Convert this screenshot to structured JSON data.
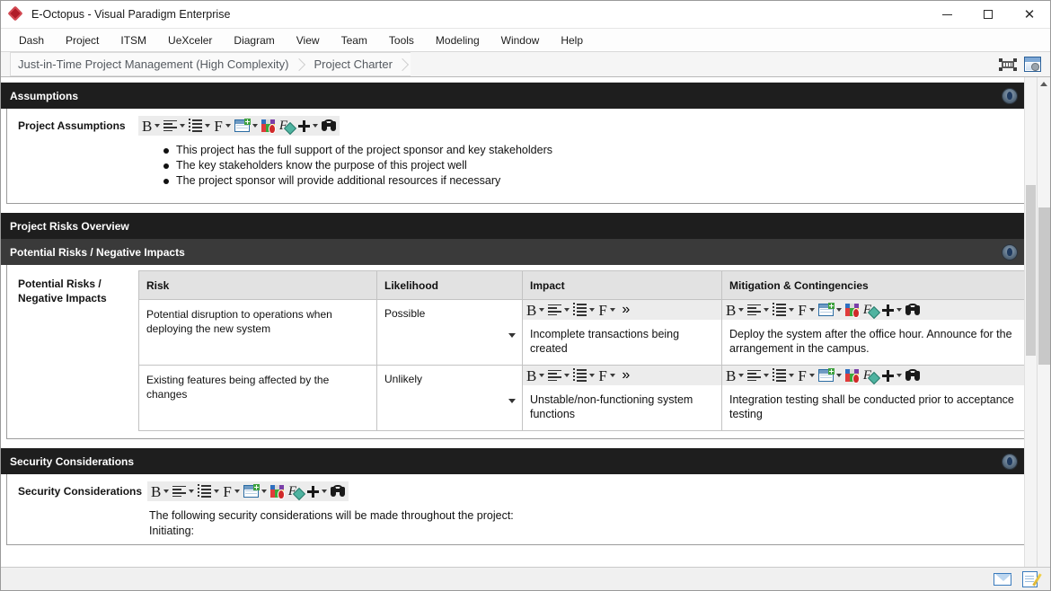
{
  "window": {
    "title": "E-Octopus - Visual Paradigm Enterprise",
    "logo_icon": "vp-diamond-logo",
    "minimize_label": "—",
    "maximize_label": "□",
    "close_label": "✕"
  },
  "menu": {
    "items": [
      {
        "label": "Dash"
      },
      {
        "label": "Project"
      },
      {
        "label": "ITSM"
      },
      {
        "label": "UeXceler"
      },
      {
        "label": "Diagram"
      },
      {
        "label": "View"
      },
      {
        "label": "Team"
      },
      {
        "label": "Tools"
      },
      {
        "label": "Modeling"
      },
      {
        "label": "Window"
      },
      {
        "label": "Help"
      }
    ]
  },
  "breadcrumb": {
    "items": [
      {
        "label": "Just-in-Time Project Management (High Complexity)"
      },
      {
        "label": "Project Charter"
      }
    ],
    "tools": [
      {
        "icon": "fit-frame-icon"
      },
      {
        "icon": "window-settings-icon"
      }
    ]
  },
  "toolbar_icons": {
    "bold": "bold-icon",
    "align": "align-icon",
    "list": "list-icon",
    "font": "font-icon",
    "table": "table-icon",
    "colors": "color-palette-icon",
    "painter": "format-painter-icon",
    "plus": "insert-plus-icon",
    "find": "binoculars-find-icon",
    "overflow": "»"
  },
  "sections": {
    "assumptions": {
      "header": "Assumptions",
      "badge_icon": "section-options-icon",
      "field_label": "Project Assumptions",
      "bullets": [
        "This project has the full support of the project sponsor and key stakeholders",
        "The key stakeholders know the purpose of this project well",
        "The project sponsor will provide additional resources if necessary"
      ]
    },
    "risks_overview": {
      "header": "Project Risks Overview"
    },
    "potential_risks": {
      "header": "Potential Risks / Negative Impacts",
      "badge_icon": "section-options-icon",
      "field_label": "Potential Risks /\nNegative Impacts",
      "columns": [
        "Risk",
        "Likelihood",
        "Impact",
        "Mitigation & Contingencies"
      ],
      "rows": [
        {
          "risk": "Potential disruption to operations when deploying the new system",
          "likelihood": "Possible",
          "impact": "Incomplete transactions being created",
          "mitigation": "Deploy the system after the office hour. Announce for the arrangement in the campus."
        },
        {
          "risk": "Existing features being affected by the changes",
          "likelihood": "Unlikely",
          "impact": "Unstable/non-functioning system functions",
          "mitigation": "Integration testing shall be conducted prior to acceptance testing"
        }
      ]
    },
    "security": {
      "header": "Security Considerations",
      "badge_icon": "section-options-icon",
      "field_label": "Security Considerations",
      "text_line_1": "The following security considerations will be made throughout the project:",
      "text_line_2": "Initiating:"
    }
  },
  "statusbar": {
    "mail_icon": "mail-icon",
    "note_icon": "note-edit-icon"
  },
  "colors": {
    "header_dark": "#1e1e1e",
    "header_mid": "#3a3a3a",
    "table_header": "#e2e2e2",
    "brand_red": "#b01c28"
  }
}
